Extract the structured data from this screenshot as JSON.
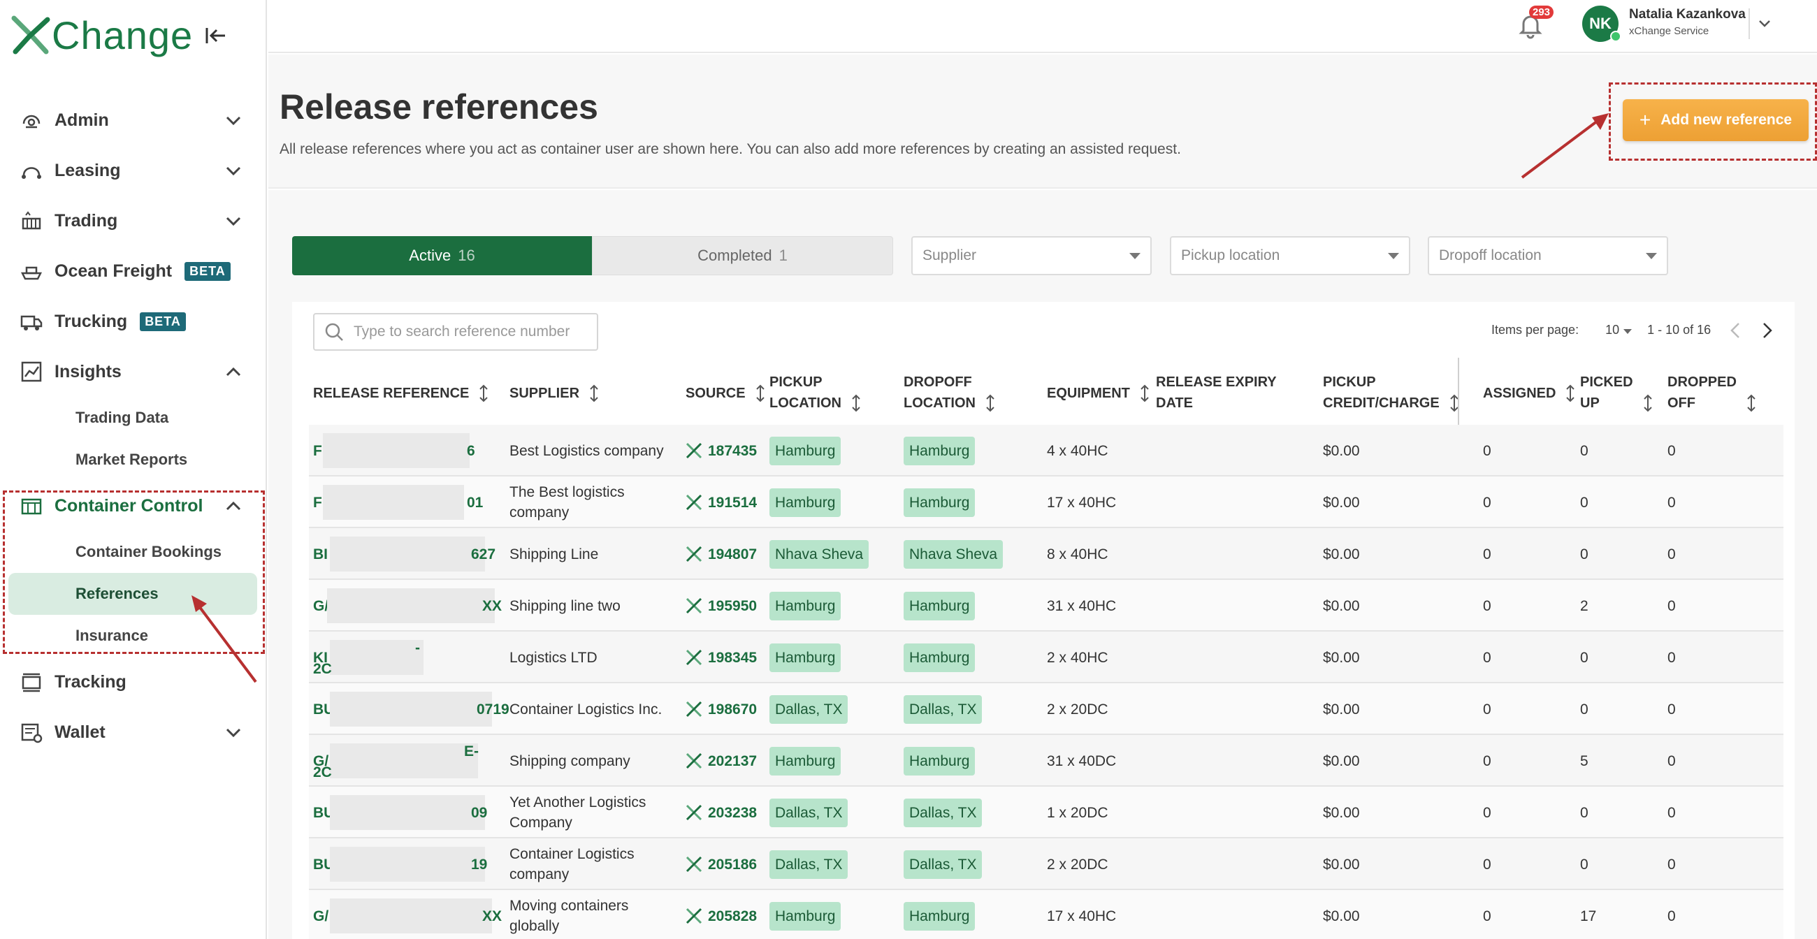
{
  "app": {
    "logo_text": "Change"
  },
  "sidebar": {
    "items": [
      {
        "label": "Admin",
        "icon": "admin-icon",
        "expanded": false
      },
      {
        "label": "Leasing",
        "icon": "leasing-icon",
        "expanded": false
      },
      {
        "label": "Trading",
        "icon": "trading-icon",
        "expanded": false
      },
      {
        "label": "Ocean Freight",
        "icon": "ship-icon",
        "badge": "BETA"
      },
      {
        "label": "Trucking",
        "icon": "truck-icon",
        "badge": "BETA"
      },
      {
        "label": "Insights",
        "icon": "insights-icon",
        "expanded": true
      }
    ],
    "insights_sub": [
      "Trading Data",
      "Market Reports"
    ],
    "container_control": {
      "label": "Container Control",
      "sub": [
        "Container Bookings",
        "References",
        "Insurance"
      ]
    },
    "tracking": {
      "label": "Tracking"
    },
    "wallet": {
      "label": "Wallet"
    }
  },
  "header": {
    "notifications": "293",
    "avatar_initials": "NK",
    "user_name": "Natalia Kazankova",
    "user_role": "xChange Service"
  },
  "page": {
    "title": "Release references",
    "description": "All release references where you act as container user are shown here. You can also add more references by creating an assisted request.",
    "add_button": "Add new reference"
  },
  "tabs": [
    {
      "label": "Active",
      "count": "16"
    },
    {
      "label": "Completed",
      "count": "1"
    }
  ],
  "filters": {
    "supplier": "Supplier",
    "pickup": "Pickup location",
    "dropoff": "Dropoff location"
  },
  "search": {
    "placeholder": "Type to search reference number"
  },
  "pager": {
    "items_per_page_label": "Items per page:",
    "items_per_page": "10",
    "range": "1 - 10 of 16"
  },
  "columns": {
    "ref": "RELEASE REFERENCE",
    "supplier": "SUPPLIER",
    "source": "SOURCE",
    "pickup1": "PICKUP",
    "pickup2": "LOCATION",
    "dropoff1": "DROPOFF",
    "dropoff2": "LOCATION",
    "equipment": "EQUIPMENT",
    "expiry1": "RELEASE EXPIRY",
    "expiry2": "DATE",
    "credit1": "PICKUP",
    "credit2": "CREDIT/CHARGE",
    "assigned": "ASSIGNED",
    "picked1": "PICKED",
    "picked2": "UP",
    "dropped1": "DROPPED",
    "dropped2": "OFF"
  },
  "rows": [
    {
      "ref_start": "F",
      "ref_end": "6",
      "supplier": "Best Logistics company",
      "source": "187435",
      "pickup": "Hamburg",
      "dropoff": "Hamburg",
      "equipment": "4 x 40HC",
      "expiry": "",
      "credit": "$0.00",
      "assigned": "0",
      "picked": "0",
      "dropped": "0"
    },
    {
      "ref_start": "F",
      "ref_end": "01",
      "supplier": "The Best logistics company",
      "source": "191514",
      "pickup": "Hamburg",
      "dropoff": "Hamburg",
      "equipment": "17 x 40HC",
      "expiry": "",
      "credit": "$0.00",
      "assigned": "0",
      "picked": "0",
      "dropped": "0"
    },
    {
      "ref_start": "BI",
      "ref_end": "627",
      "supplier": "Shipping Line",
      "source": "194807",
      "pickup": "Nhava Sheva",
      "dropoff": "Nhava Sheva",
      "equipment": "8 x 40HC",
      "expiry": "",
      "credit": "$0.00",
      "assigned": "0",
      "picked": "0",
      "dropped": "0"
    },
    {
      "ref_start": "G/",
      "ref_end": "XX",
      "supplier": "Shipping line two",
      "source": "195950",
      "pickup": "Hamburg",
      "dropoff": "Hamburg",
      "equipment": "31 x 40HC",
      "expiry": "",
      "credit": "$0.00",
      "assigned": "0",
      "picked": "2",
      "dropped": "0"
    },
    {
      "ref_start": "KI",
      "ref_end": "-",
      "ref_line2": "2C",
      "supplier": "Logistics LTD",
      "source": "198345",
      "pickup": "Hamburg",
      "dropoff": "Hamburg",
      "equipment": "2 x 40HC",
      "expiry": "",
      "credit": "$0.00",
      "assigned": "0",
      "picked": "0",
      "dropped": "0"
    },
    {
      "ref_start": "BU",
      "ref_end": "0719",
      "supplier": "Container Logistics Inc.",
      "source": "198670",
      "pickup": "Dallas, TX",
      "dropoff": "Dallas, TX",
      "equipment": "2 x 20DC",
      "expiry": "",
      "credit": "$0.00",
      "assigned": "0",
      "picked": "0",
      "dropped": "0"
    },
    {
      "ref_start": "G/",
      "ref_end": "E-",
      "ref_line2": "2C",
      "supplier": "Shipping company",
      "source": "202137",
      "pickup": "Hamburg",
      "dropoff": "Hamburg",
      "equipment": "31 x 40DC",
      "expiry": "",
      "credit": "$0.00",
      "assigned": "0",
      "picked": "5",
      "dropped": "0"
    },
    {
      "ref_start": "BU",
      "ref_end": "09",
      "supplier": "Yet Another Logistics Company",
      "source": "203238",
      "pickup": "Dallas, TX",
      "dropoff": "Dallas, TX",
      "equipment": "1 x 20DC",
      "expiry": "",
      "credit": "$0.00",
      "assigned": "0",
      "picked": "0",
      "dropped": "0"
    },
    {
      "ref_start": "BU",
      "ref_end": "19",
      "supplier": "Container Logistics company",
      "source": "205186",
      "pickup": "Dallas, TX",
      "dropoff": "Dallas, TX",
      "equipment": "2 x 20DC",
      "expiry": "",
      "credit": "$0.00",
      "assigned": "0",
      "picked": "0",
      "dropped": "0"
    },
    {
      "ref_start": "G/",
      "ref_end": "XX",
      "supplier": "Moving containers globally",
      "source": "205828",
      "pickup": "Hamburg",
      "dropoff": "Hamburg",
      "equipment": "17 x 40HC",
      "expiry": "",
      "credit": "$0.00",
      "assigned": "0",
      "picked": "17",
      "dropped": "0"
    }
  ],
  "colors": {
    "brand_green": "#1b6e3f",
    "accent_orange": "#f0a538",
    "annotation_red": "#b73030",
    "location_chip": "#b7e4cb"
  }
}
